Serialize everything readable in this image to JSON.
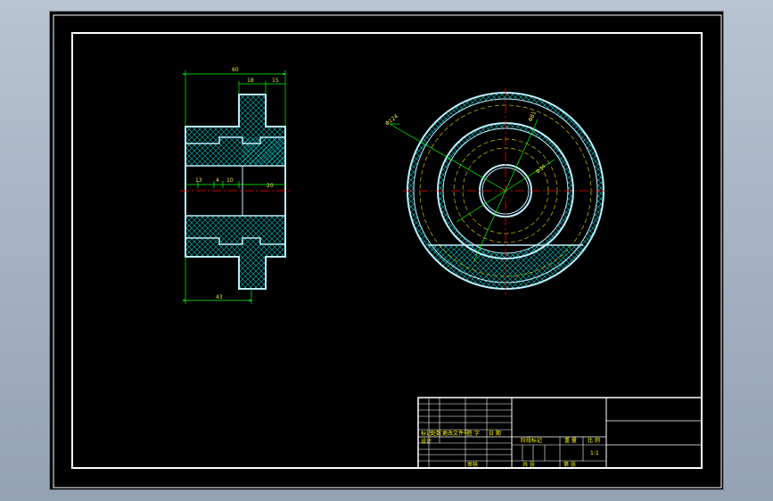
{
  "colors": {
    "background": "#000000",
    "frame": "#ffffff",
    "outline": "#bfeeff",
    "hatch": "#00c8c8",
    "dimension": "#00ff00",
    "dimension_text": "#e8e840",
    "centerline": "#ff0000",
    "hidden": "#c8c800",
    "desktop": "#a6b2c2"
  },
  "section_view": {
    "dimensions": {
      "overall_length": "60",
      "hub_step": "18",
      "hub_right": "15",
      "bore_a": "13",
      "bore_b": "4",
      "bore_c": "10",
      "bore_d": "20",
      "bottom_length": "43"
    }
  },
  "end_view": {
    "dimensions": {
      "outer_diameter": "Φ124",
      "bolt_circle": "Φ81",
      "bore": "Φ34"
    }
  },
  "title_block": {
    "row_labels": [
      "标记",
      "处数",
      "更改文件号",
      "签 字",
      "日 期"
    ],
    "design": "设计",
    "review": "审核",
    "stage_mark": "阶段标记",
    "weight": "重 量",
    "scale_label": "比 例",
    "scale_value": "1:1",
    "sheet_total": "共    张",
    "sheet_index": "第    张"
  }
}
